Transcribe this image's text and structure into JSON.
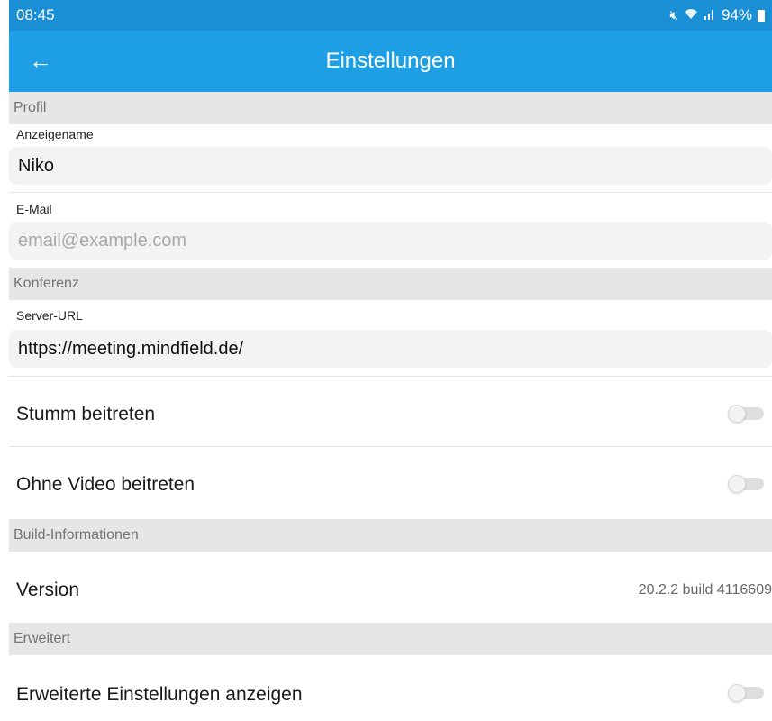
{
  "status_bar": {
    "time": "08:45",
    "battery": "94%",
    "icons": [
      "mute-icon",
      "wifi-icon",
      "signal-icon",
      "battery-icon"
    ]
  },
  "app_bar": {
    "title": "Einstellungen",
    "back_icon": "arrow-left-icon"
  },
  "profile": {
    "section_title": "Profil",
    "display_name_label": "Anzeigename",
    "display_name_value": "Niko",
    "email_label": "E-Mail",
    "email_value": "",
    "email_placeholder": "email@example.com"
  },
  "conference": {
    "section_title": "Konferenz",
    "server_url_label": "Server-URL",
    "server_url_value": "https://meeting.mindfield.de/",
    "mute_label": "Stumm beitreten",
    "mute_on": false,
    "no_video_label": "Ohne Video beitreten",
    "no_video_on": false
  },
  "build_info": {
    "section_title": "Build-Informationen",
    "version_label": "Version",
    "version_value": "20.2.2 build 4116609"
  },
  "advanced": {
    "section_title": "Erweitert",
    "show_advanced_label": "Erweiterte Einstellungen anzeigen",
    "show_advanced_on": false
  },
  "colors": {
    "status_bar": "#1a8fd6",
    "app_bar": "#1e9fe3",
    "section_header_bg": "#e6e6e6"
  }
}
